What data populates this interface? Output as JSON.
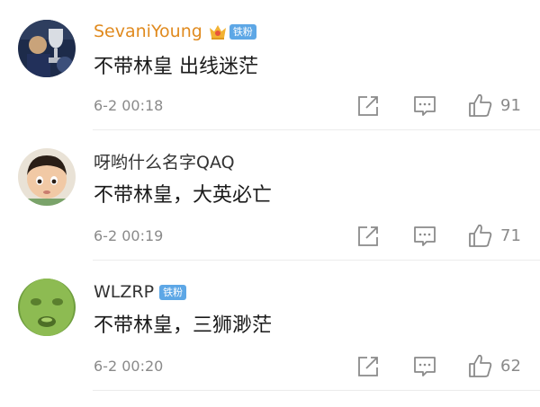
{
  "comments": [
    {
      "username": "SevaniYoung",
      "username_color": "#e08a1e",
      "badge": "铁粉",
      "text": "不带林皇 出线迷茫",
      "time": "6-2 00:18",
      "likes": "91",
      "avatar_icon": "trophy-photo-avatar"
    },
    {
      "username": "呀哟什么名字QAQ",
      "username_color": "#333333",
      "badge": "",
      "text": "不带林皇，大英必亡",
      "time": "6-2 00:19",
      "likes": "71",
      "avatar_icon": "child-photo-avatar"
    },
    {
      "username": "WLZRP",
      "username_color": "#333333",
      "badge": "铁粉",
      "text": "不带林皇，三狮渺茫",
      "time": "6-2 00:20",
      "likes": "62",
      "avatar_icon": "green-face-avatar"
    }
  ],
  "icons": {
    "share": "share-icon",
    "comment": "comment-icon",
    "like": "thumbs-up-icon"
  }
}
